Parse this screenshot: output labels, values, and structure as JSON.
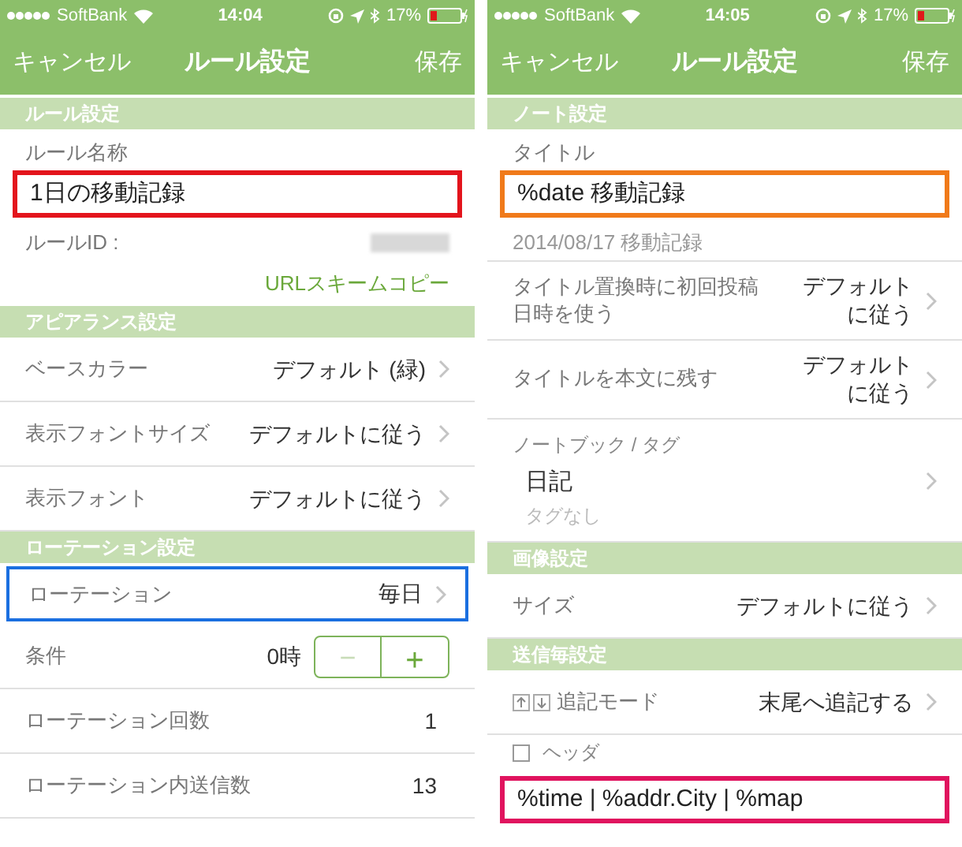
{
  "screens": [
    {
      "status_bar": {
        "carrier": "SoftBank",
        "time": "14:04",
        "battery": "17%"
      },
      "nav": {
        "cancel": "キャンセル",
        "title": "ルール設定",
        "save": "保存"
      },
      "sections": [
        {
          "header": "ルール設定",
          "rows": [
            {
              "kind": "label",
              "text": "ルール名称"
            },
            {
              "kind": "text_field",
              "value": "1日の移動記録",
              "color": "#e3141c"
            },
            {
              "kind": "info",
              "label": "ルールID :"
            },
            {
              "kind": "link",
              "text": "URLスキームコピー"
            }
          ]
        },
        {
          "header": "アピアランス設定",
          "rows": [
            {
              "kind": "disclosure",
              "label": "ベースカラー",
              "value": "デフォルト (緑)"
            },
            {
              "kind": "disclosure",
              "label": "表示フォントサイズ",
              "value": "デフォルトに従う"
            },
            {
              "kind": "disclosure",
              "label": "表示フォント",
              "value": "デフォルトに従う"
            }
          ]
        },
        {
          "header": "ローテーション設定",
          "rows": [
            {
              "kind": "disclosure",
              "label": "ローテーション",
              "value": "毎日",
              "color": "#1a6fe0"
            },
            {
              "kind": "stepper",
              "label": "条件",
              "value": "0時",
              "minus": "−",
              "plus": "+"
            },
            {
              "kind": "value",
              "label": "ローテーション回数",
              "value": "1"
            },
            {
              "kind": "value",
              "label": "ローテーション内送信数",
              "value": "13"
            }
          ]
        }
      ]
    },
    {
      "status_bar": {
        "carrier": "SoftBank",
        "time": "14:05",
        "battery": "17%"
      },
      "nav": {
        "cancel": "キャンセル",
        "title": "ルール設定",
        "save": "保存"
      },
      "sections": [
        {
          "header": "ノート設定",
          "rows": [
            {
              "kind": "label",
              "text": "タイトル"
            },
            {
              "kind": "text_field",
              "value": "%date 移動記録",
              "color": "#f07a1a"
            },
            {
              "kind": "caption",
              "text": "2014/08/17 移動記録"
            },
            {
              "kind": "disclosure",
              "label": "タイトル置換時に初回投稿日時を使う",
              "value": "デフォルトに従う"
            },
            {
              "kind": "disclosure",
              "label": "タイトルを本文に残す",
              "value": "デフォルトに従う"
            },
            {
              "kind": "notebook",
              "label": "ノートブック / タグ",
              "value": "日記",
              "sub": "タグなし"
            }
          ]
        },
        {
          "header": "画像設定",
          "rows": [
            {
              "kind": "disclosure",
              "label": "サイズ",
              "value": "デフォルトに従う"
            }
          ]
        },
        {
          "header": "送信毎設定",
          "rows": [
            {
              "kind": "append_mode",
              "label": "追記モード",
              "value": "末尾へ追記する"
            },
            {
              "kind": "checkbox",
              "label": "ヘッダ",
              "checked": false
            },
            {
              "kind": "text_field",
              "value": "%time | %addr.City | %map",
              "color": "#e0135e"
            }
          ]
        }
      ]
    }
  ]
}
